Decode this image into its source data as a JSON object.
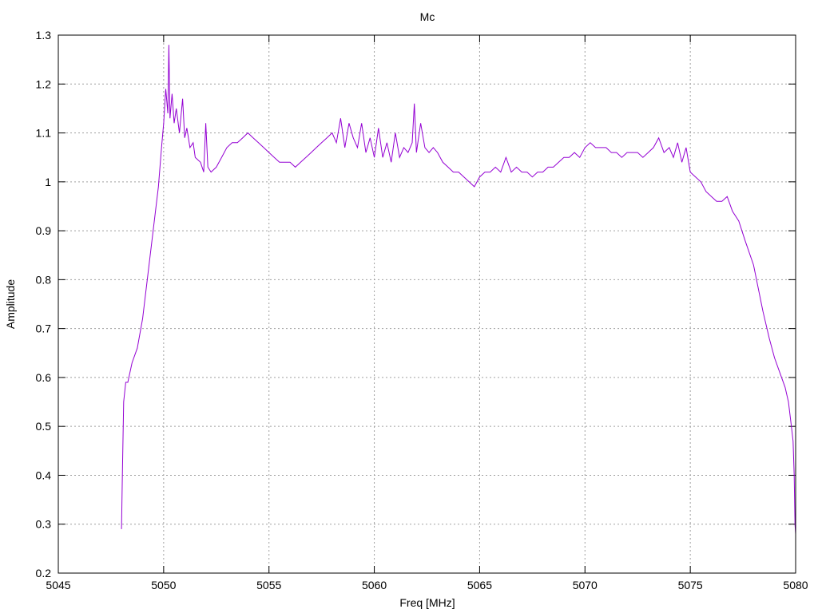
{
  "chart_data": {
    "type": "line",
    "title": "Mc",
    "xlabel": "Freq [MHz]",
    "ylabel": "Amplitude",
    "xlim": [
      5045,
      5080
    ],
    "ylim": [
      0.2,
      1.3
    ],
    "xticks": [
      5045,
      5050,
      5055,
      5060,
      5065,
      5070,
      5075,
      5080
    ],
    "yticks": [
      0.2,
      0.3,
      0.4,
      0.5,
      0.6,
      0.7,
      0.8,
      0.9,
      1,
      1.1,
      1.2,
      1.3
    ],
    "xtick_labels": [
      "5045",
      "5050",
      "5055",
      "5060",
      "5065",
      "5070",
      "5075",
      "5080"
    ],
    "ytick_labels": [
      "0.2",
      "0.3",
      "0.4",
      "0.5",
      "0.6",
      "0.7",
      "0.8",
      "0.9",
      "1",
      "1.1",
      "1.2",
      "1.3"
    ],
    "grid": true,
    "legend": "none",
    "series": [
      {
        "name": "Mc",
        "color": "#9400d3",
        "x": [
          5048.0,
          5048.05,
          5048.1,
          5048.2,
          5048.3,
          5048.5,
          5048.75,
          5049.0,
          5049.25,
          5049.5,
          5049.75,
          5049.9,
          5050.0,
          5050.1,
          5050.2,
          5050.25,
          5050.3,
          5050.4,
          5050.5,
          5050.6,
          5050.75,
          5050.9,
          5051.0,
          5051.1,
          5051.25,
          5051.4,
          5051.5,
          5051.75,
          5051.9,
          5052.0,
          5052.1,
          5052.25,
          5052.5,
          5052.75,
          5053.0,
          5053.25,
          5053.5,
          5053.75,
          5054.0,
          5054.25,
          5054.5,
          5054.75,
          5055.0,
          5055.25,
          5055.5,
          5055.75,
          5056.0,
          5056.25,
          5056.5,
          5056.75,
          5057.0,
          5057.25,
          5057.5,
          5057.75,
          5058.0,
          5058.2,
          5058.4,
          5058.6,
          5058.8,
          5059.0,
          5059.2,
          5059.4,
          5059.6,
          5059.8,
          5060.0,
          5060.2,
          5060.4,
          5060.6,
          5060.8,
          5061.0,
          5061.2,
          5061.4,
          5061.6,
          5061.8,
          5061.9,
          5062.0,
          5062.2,
          5062.4,
          5062.6,
          5062.8,
          5063.0,
          5063.25,
          5063.5,
          5063.75,
          5064.0,
          5064.25,
          5064.5,
          5064.75,
          5065.0,
          5065.25,
          5065.5,
          5065.75,
          5066.0,
          5066.25,
          5066.5,
          5066.75,
          5067.0,
          5067.25,
          5067.5,
          5067.75,
          5068.0,
          5068.25,
          5068.5,
          5068.75,
          5069.0,
          5069.25,
          5069.5,
          5069.75,
          5070.0,
          5070.25,
          5070.5,
          5070.75,
          5071.0,
          5071.25,
          5071.5,
          5071.75,
          5072.0,
          5072.25,
          5072.5,
          5072.75,
          5073.0,
          5073.25,
          5073.5,
          5073.75,
          5074.0,
          5074.2,
          5074.4,
          5074.6,
          5074.8,
          5075.0,
          5075.25,
          5075.5,
          5075.75,
          5076.0,
          5076.25,
          5076.5,
          5076.75,
          5077.0,
          5077.3,
          5077.6,
          5078.0,
          5078.45,
          5078.75,
          5079.0,
          5079.25,
          5079.5,
          5079.66,
          5079.8,
          5079.88,
          5079.93,
          5079.97,
          5080.0
        ],
        "y": [
          0.29,
          0.42,
          0.55,
          0.59,
          0.59,
          0.63,
          0.66,
          0.72,
          0.81,
          0.9,
          0.99,
          1.07,
          1.12,
          1.19,
          1.14,
          1.28,
          1.13,
          1.18,
          1.12,
          1.15,
          1.1,
          1.17,
          1.09,
          1.11,
          1.07,
          1.08,
          1.05,
          1.04,
          1.02,
          1.12,
          1.03,
          1.02,
          1.03,
          1.05,
          1.07,
          1.08,
          1.08,
          1.09,
          1.1,
          1.09,
          1.08,
          1.07,
          1.06,
          1.05,
          1.04,
          1.04,
          1.04,
          1.03,
          1.04,
          1.05,
          1.06,
          1.07,
          1.08,
          1.09,
          1.1,
          1.08,
          1.13,
          1.07,
          1.12,
          1.09,
          1.07,
          1.12,
          1.06,
          1.09,
          1.05,
          1.11,
          1.05,
          1.08,
          1.04,
          1.1,
          1.05,
          1.07,
          1.06,
          1.08,
          1.16,
          1.06,
          1.12,
          1.07,
          1.06,
          1.07,
          1.06,
          1.04,
          1.03,
          1.02,
          1.02,
          1.01,
          1.0,
          0.99,
          1.01,
          1.02,
          1.02,
          1.03,
          1.02,
          1.05,
          1.02,
          1.03,
          1.02,
          1.02,
          1.01,
          1.02,
          1.02,
          1.03,
          1.03,
          1.04,
          1.05,
          1.05,
          1.06,
          1.05,
          1.07,
          1.08,
          1.07,
          1.07,
          1.07,
          1.06,
          1.06,
          1.05,
          1.06,
          1.06,
          1.06,
          1.05,
          1.06,
          1.07,
          1.09,
          1.06,
          1.07,
          1.05,
          1.08,
          1.04,
          1.07,
          1.02,
          1.01,
          1.0,
          0.98,
          0.97,
          0.96,
          0.96,
          0.97,
          0.94,
          0.92,
          0.88,
          0.83,
          0.735,
          0.68,
          0.64,
          0.61,
          0.58,
          0.55,
          0.5,
          0.47,
          0.4,
          0.3,
          0.28
        ]
      }
    ]
  }
}
